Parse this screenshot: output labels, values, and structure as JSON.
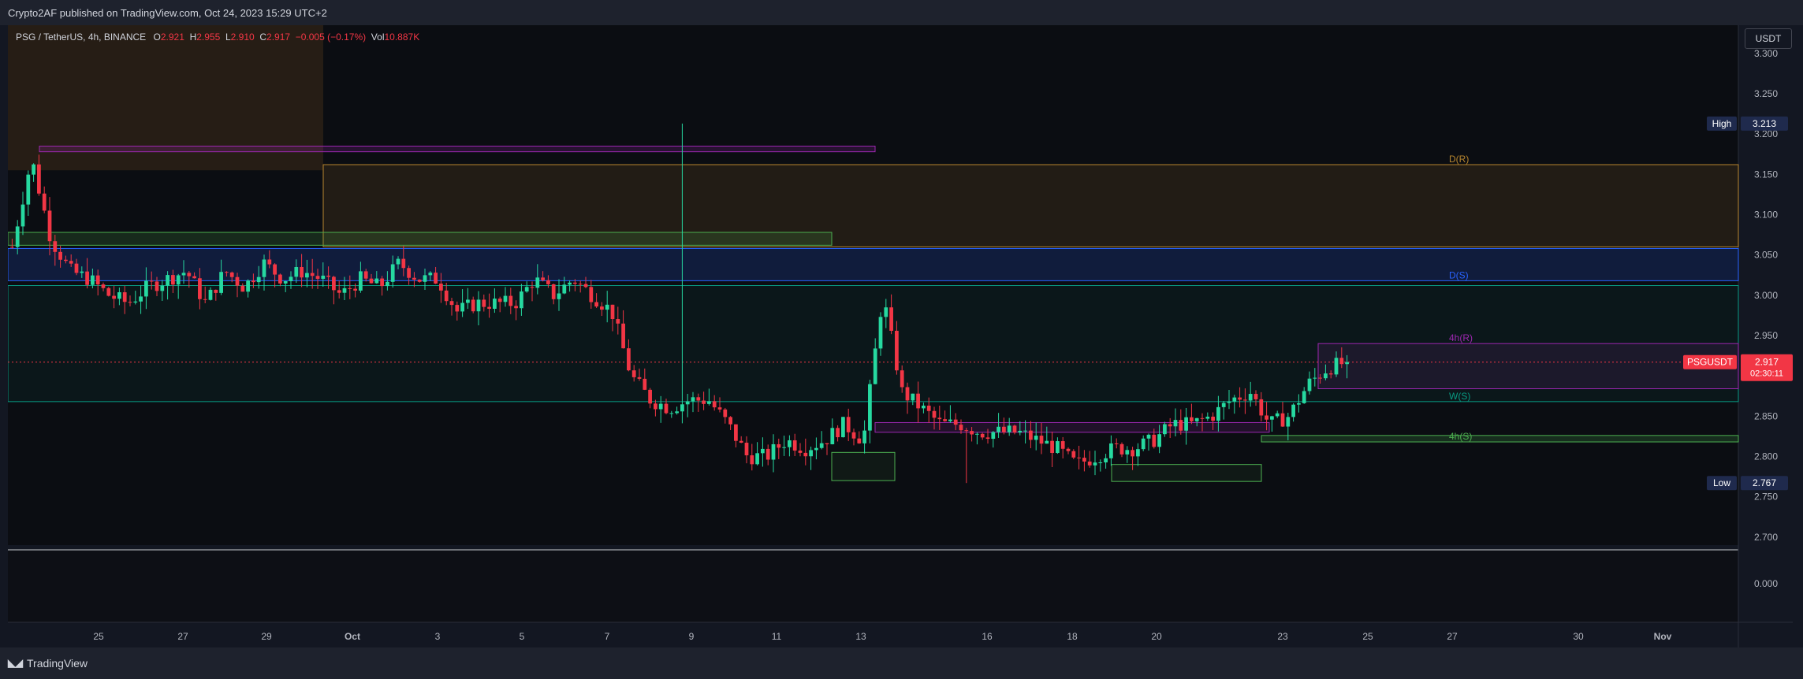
{
  "header": {
    "published": "Crypto2AF published on TradingView.com, Oct 24, 2023 15:29 UTC+2"
  },
  "legend": {
    "symbol": "PSG / TetherUS, 4h, BINANCE",
    "o_label": "O",
    "o": "2.921",
    "h_label": "H",
    "h": "2.955",
    "l_label": "L",
    "l": "2.910",
    "c_label": "C",
    "c": "2.917",
    "change": "−0.005 (−0.17%)",
    "vol_label": "Vol",
    "vol": "10.887K"
  },
  "currency": "USDT",
  "footer": {
    "brand": "TradingView"
  },
  "colors": {
    "bg": "#131722",
    "up": "#089981",
    "up_bright": "#26d9a0",
    "down": "#f23645",
    "grid": "#1e222d"
  },
  "chart_data": {
    "type": "candlestick",
    "timeframe": "4h",
    "ylim": [
      2.69,
      3.335
    ],
    "y_ticks": [
      "3.300",
      "3.250",
      "3.200",
      "3.150",
      "3.100",
      "3.050",
      "3.000",
      "2.950",
      "2.900",
      "2.850",
      "2.800",
      "2.750",
      "2.700"
    ],
    "volume_axis_label": "0.000",
    "x_ticks": [
      "25",
      "27",
      "29",
      "Oct",
      "3",
      "5",
      "7",
      "9",
      "11",
      "13",
      "16",
      "18",
      "20",
      "23",
      "25",
      "27",
      "30",
      "Nov"
    ],
    "price_labels": {
      "high": {
        "label": "High",
        "value": "3.213"
      },
      "low": {
        "label": "Low",
        "value": "2.767"
      },
      "last": {
        "label": "PSGUSDT",
        "value": "2.917",
        "countdown": "02:30:11"
      }
    },
    "zone_labels": {
      "d_resistance": "D(R)",
      "d_support": "D(S)",
      "h4_resistance": "4h(R)",
      "w_support": "W(S)",
      "h4_support": "4h(S)"
    },
    "anchor_closes": [
      3.06,
      3.17,
      3.07,
      3.03,
      3.02,
      3.0,
      2.99,
      3.01,
      3.02,
      3.03,
      2.99,
      3.03,
      3.01,
      3.04,
      3.02,
      3.03,
      3.02,
      3.0,
      3.02,
      3.01,
      3.04,
      3.02,
      3.02,
      2.98,
      2.99,
      2.99,
      2.99,
      3.02,
      3.0,
      3.02,
      3.0,
      2.98,
      2.9,
      2.87,
      2.86,
      2.87,
      2.87,
      2.84,
      2.8,
      2.8,
      2.82,
      2.81,
      2.82,
      2.84,
      2.82,
      3.0,
      2.88,
      2.86,
      2.84,
      2.84,
      2.83,
      2.83,
      2.83,
      2.82,
      2.81,
      2.79,
      2.8,
      2.81,
      2.81,
      2.82,
      2.84,
      2.84,
      2.85,
      2.87,
      2.88,
      2.84,
      2.85,
      2.89,
      2.91,
      2.917
    ],
    "high": 3.213,
    "low": 2.767,
    "last": 2.917
  }
}
